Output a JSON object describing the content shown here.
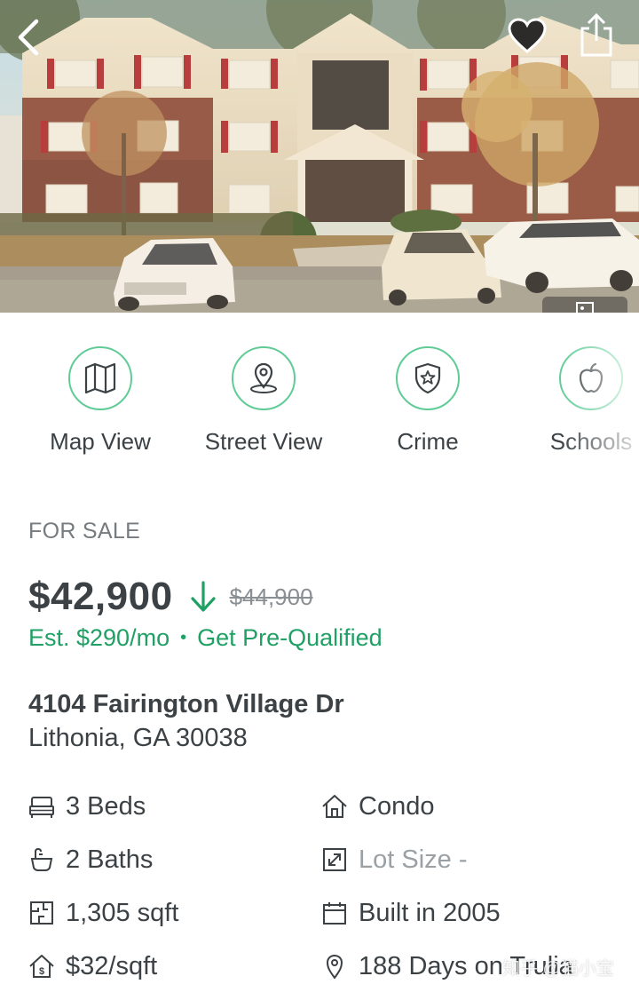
{
  "hero": {
    "back_icon": "chevron-left-icon",
    "favorite_icon": "heart-icon",
    "share_icon": "share-icon",
    "photo_count_icon": "photo-icon"
  },
  "actions": [
    {
      "label": "Map View",
      "icon": "map-icon"
    },
    {
      "label": "Street View",
      "icon": "map-pin-icon"
    },
    {
      "label": "Crime",
      "icon": "shield-star-icon"
    },
    {
      "label": "Schools",
      "icon": "apple-icon"
    }
  ],
  "listing": {
    "status": "FOR SALE",
    "price": "$42,900",
    "price_drop_icon": "arrow-down-icon",
    "old_price": "$44,900",
    "estimate": "Est. $290/mo",
    "separator": "•",
    "prequalify": "Get Pre-Qualified",
    "address_line1": "4104 Fairington Village Dr",
    "address_line2": "Lithonia, GA 30038"
  },
  "facts": [
    {
      "text": "3 Beds",
      "icon": "bed-icon"
    },
    {
      "text": "Condo",
      "icon": "house-icon"
    },
    {
      "text": "2 Baths",
      "icon": "bath-icon"
    },
    {
      "text": "Lot Size -",
      "icon": "expand-icon"
    },
    {
      "text": "1,305 sqft",
      "icon": "floorplan-icon"
    },
    {
      "text": "Built in 2005",
      "icon": "calendar-icon"
    },
    {
      "text": "$32/sqft",
      "icon": "price-house-icon"
    },
    {
      "text": "188 Days on Trulia",
      "icon": "location-pin-icon"
    }
  ],
  "watermark": "知乎 @猫小宝",
  "colors": {
    "accent_green": "#20a064",
    "icon_ring": "#5fcc96",
    "text_dark": "#3b4144",
    "text_muted": "#767b7f"
  }
}
